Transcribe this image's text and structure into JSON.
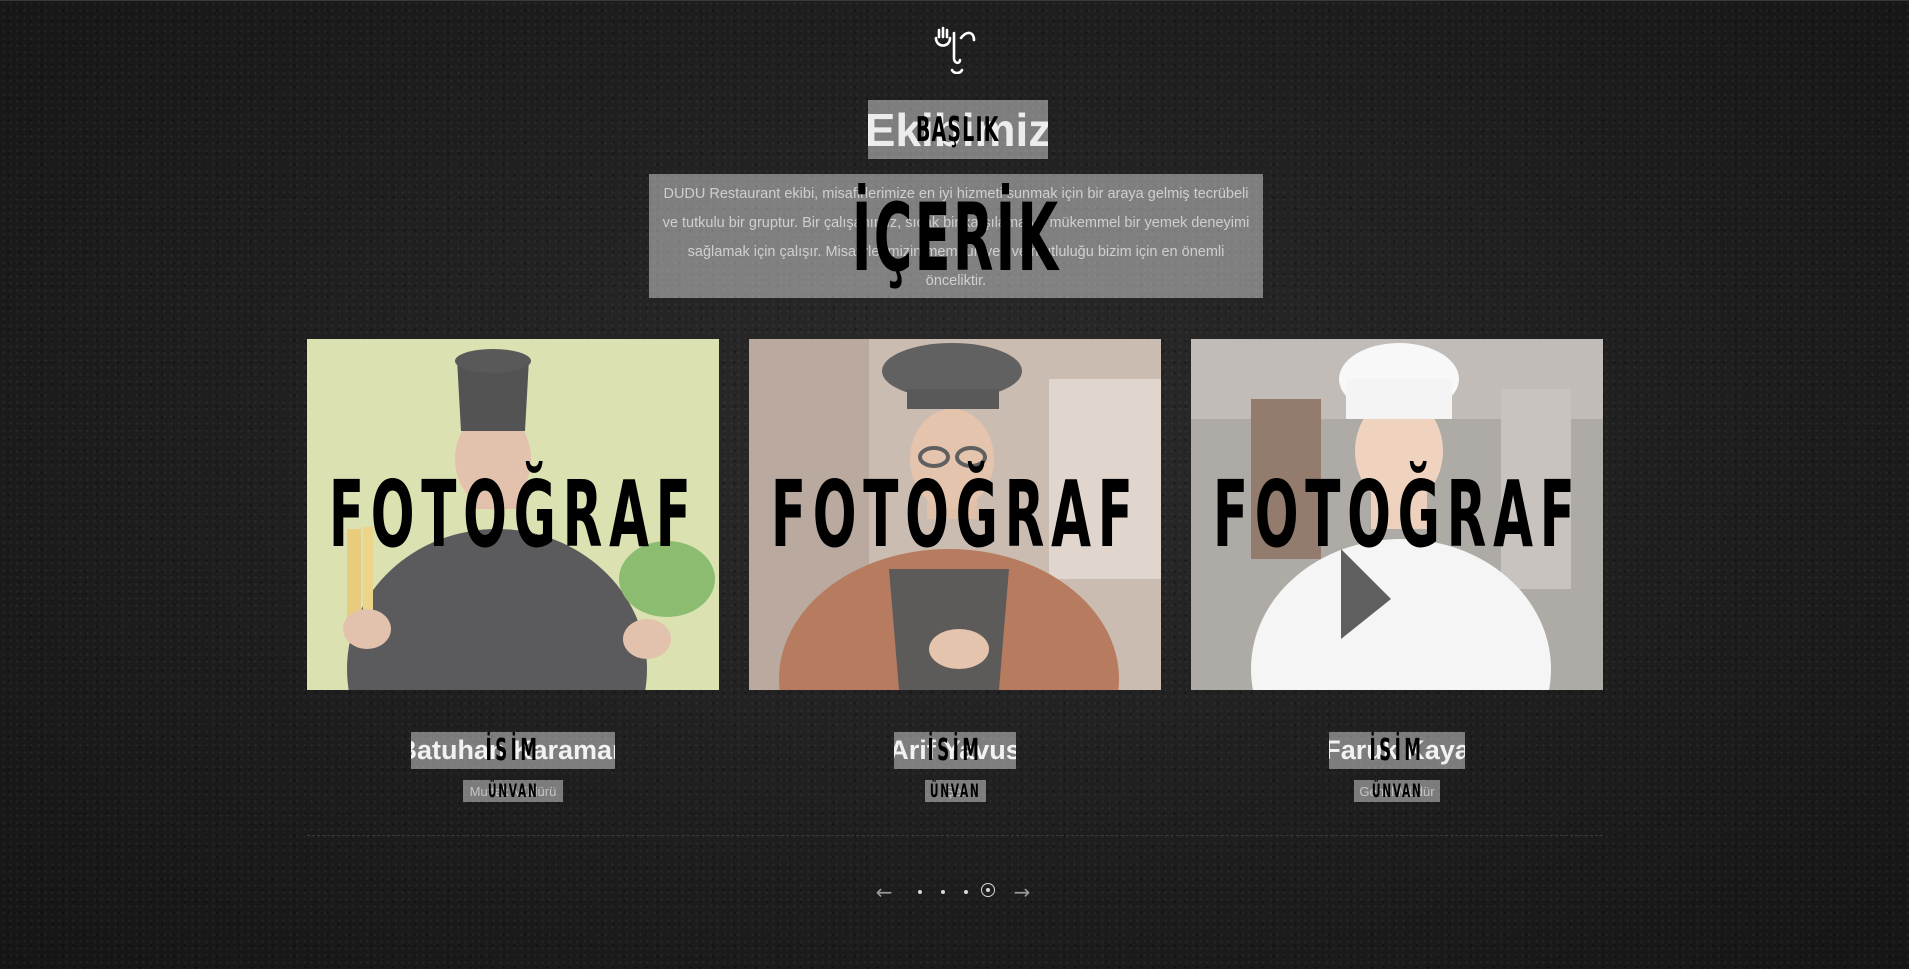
{
  "heading": {
    "text": "Ekibimiz",
    "placeholder": "BAŞLIK"
  },
  "intro": {
    "text": "DUDU Restaurant ekibi, misafirlerimize en iyi hizmeti sunmak için bir araya gelmiş tecrübeli ve tutkulu bir gruptur. Bir çalışanımız, sıcak bir karşılama ve mükemmel bir yemek deneyimi sağlamak için çalışır. Misafirlerimizin memnuniyeti ve mutluluğu bizim için en önemli önceliktir.",
    "placeholder": "İÇERİK"
  },
  "team": [
    {
      "name": "Batuhan Karaman",
      "title": "Mutfak Müdürü",
      "photo_placeholder": "FOTOĞRAF",
      "name_placeholder": "İSİM",
      "title_placeholder": "ÜNVAN"
    },
    {
      "name": "Arif Yavus",
      "title": "Şef",
      "photo_placeholder": "FOTOĞRAF",
      "name_placeholder": "İSİM",
      "title_placeholder": "ÜNVAN"
    },
    {
      "name": "Faruk Kaya",
      "title": "Genel Müdür",
      "photo_placeholder": "FOTOĞRAF",
      "name_placeholder": "İSİM",
      "title_placeholder": "ÜNVAN"
    }
  ],
  "slider": {
    "prev_icon": "arrow-left-icon",
    "next_icon": "arrow-right-icon",
    "dot_count": 4,
    "active_dot": 4
  },
  "colors": {
    "background": "#1f1f1f",
    "placeholder_overlay": "#ffffff",
    "accent_text": "#e9e9e9"
  }
}
